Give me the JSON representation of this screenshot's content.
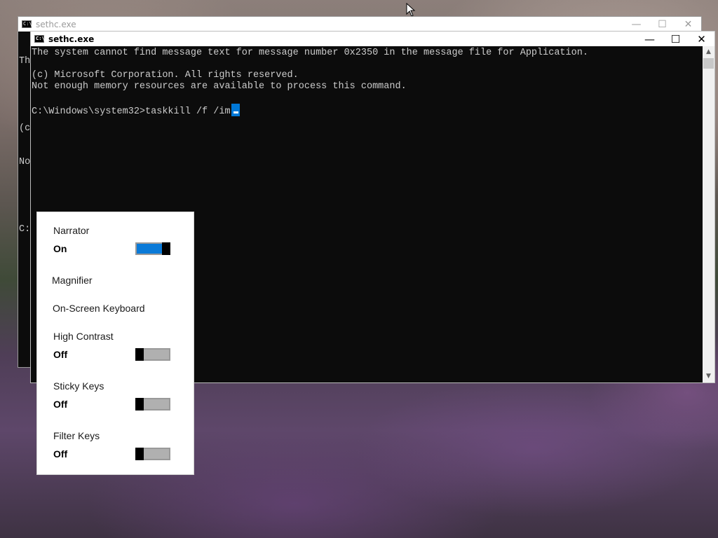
{
  "back_window": {
    "title": "sethc.exe",
    "visible_text": [
      "Th",
      "",
      "(c",
      "No",
      "",
      "C:"
    ],
    "controls": {
      "minimize": "—",
      "maximize": "☐",
      "close": "✕"
    }
  },
  "front_window": {
    "title": "sethc.exe",
    "controls": {
      "minimize": "—",
      "maximize": "☐",
      "close": "✕"
    },
    "lines": [
      "The system cannot find message text for message number 0x2350 in the message file for Application.",
      "",
      "(c) Microsoft Corporation. All rights reserved.",
      "Not enough memory resources are available to process this command.",
      ""
    ],
    "prompt": "C:\\Windows\\system32>",
    "command": "taskkill /f /im"
  },
  "accessibility_panel": {
    "items": [
      {
        "label": "Narrator",
        "state": "On",
        "toggle": "on"
      },
      {
        "label": "Magnifier"
      },
      {
        "label": "On-Screen Keyboard"
      },
      {
        "label": "High Contrast",
        "state": "Off",
        "toggle": "off"
      },
      {
        "label": "Sticky Keys",
        "state": "Off",
        "toggle": "off"
      },
      {
        "label": "Filter Keys",
        "state": "Off",
        "toggle": "off"
      }
    ]
  },
  "colors": {
    "accent": "#0078d7",
    "console_bg": "#0c0c0c",
    "console_text": "#cccccc"
  },
  "icons": [
    "cmd-icon",
    "mouse-pointer-icon",
    "scroll-up-arrow-icon",
    "scroll-down-arrow-icon"
  ]
}
